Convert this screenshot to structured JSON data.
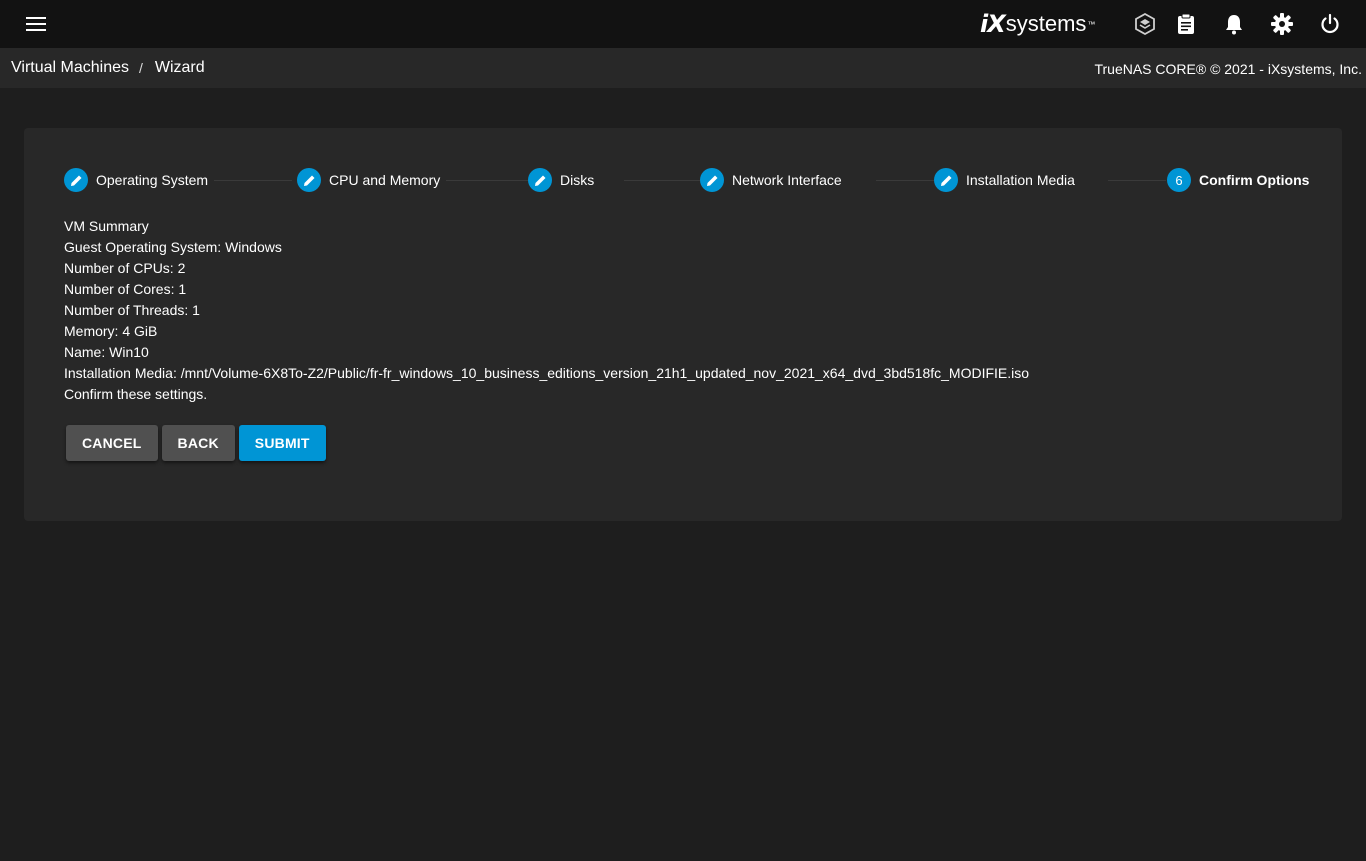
{
  "topbar": {
    "menu_icon": "hamburger-menu-icon",
    "logo": {
      "ix": "iX",
      "systems": "systems",
      "tm": "™"
    },
    "icons": [
      "truecommand-icon",
      "clipboard-icon",
      "bell-icon",
      "gear-icon",
      "power-icon"
    ]
  },
  "breadcrumb": {
    "items": [
      "Virtual Machines",
      "Wizard"
    ],
    "separator": "/"
  },
  "copyright": "TrueNAS CORE® © 2021 - iXsystems, Inc.",
  "stepper": {
    "steps": [
      {
        "label": "Operating System",
        "state": "edit"
      },
      {
        "label": "CPU and Memory",
        "state": "edit"
      },
      {
        "label": "Disks",
        "state": "edit"
      },
      {
        "label": "Network Interface",
        "state": "edit"
      },
      {
        "label": "Installation Media",
        "state": "edit"
      },
      {
        "label": "Confirm Options",
        "state": "active",
        "number": "6"
      }
    ]
  },
  "summary": {
    "lines": [
      "VM Summary",
      "Guest Operating System: Windows",
      "Number of CPUs: 2",
      "Number of Cores: 1",
      "Number of Threads: 1",
      "Memory: 4 GiB",
      "Name: Win10",
      "Installation Media: /mnt/Volume-6X8To-Z2/Public/fr-fr_windows_10_business_editions_version_21h1_updated_nov_2021_x64_dvd_3bd518fc_MODIFIE.iso",
      "Confirm these settings."
    ]
  },
  "buttons": {
    "cancel": "CANCEL",
    "back": "BACK",
    "submit": "SUBMIT"
  },
  "colors": {
    "accent": "#0095d5",
    "topbar": "#121212",
    "background": "#1e1e1e",
    "card": "#282828"
  }
}
